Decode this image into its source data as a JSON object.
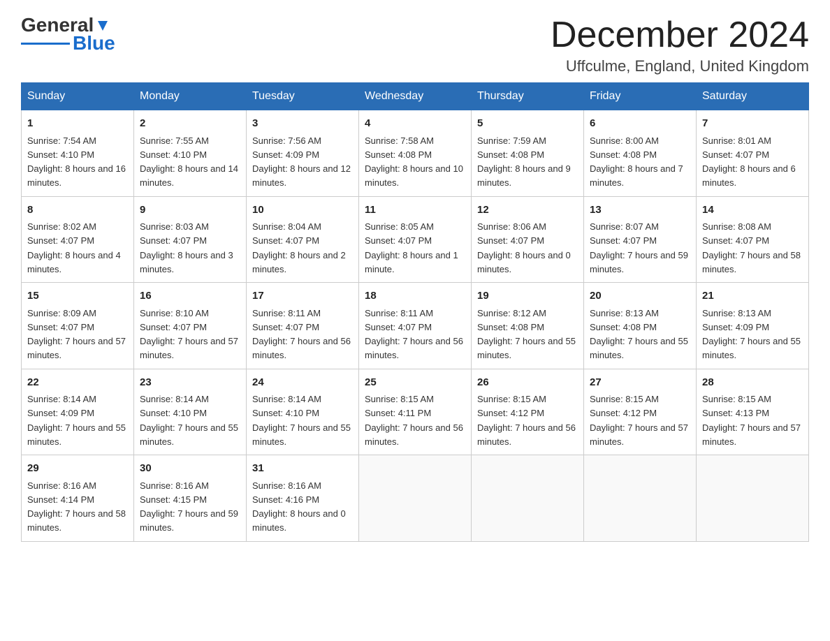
{
  "header": {
    "logo_general": "General",
    "logo_blue": "Blue",
    "month_title": "December 2024",
    "location": "Uffculme, England, United Kingdom"
  },
  "days_of_week": [
    "Sunday",
    "Monday",
    "Tuesday",
    "Wednesday",
    "Thursday",
    "Friday",
    "Saturday"
  ],
  "weeks": [
    [
      {
        "day": "1",
        "sunrise": "7:54 AM",
        "sunset": "4:10 PM",
        "daylight": "8 hours and 16 minutes."
      },
      {
        "day": "2",
        "sunrise": "7:55 AM",
        "sunset": "4:10 PM",
        "daylight": "8 hours and 14 minutes."
      },
      {
        "day": "3",
        "sunrise": "7:56 AM",
        "sunset": "4:09 PM",
        "daylight": "8 hours and 12 minutes."
      },
      {
        "day": "4",
        "sunrise": "7:58 AM",
        "sunset": "4:08 PM",
        "daylight": "8 hours and 10 minutes."
      },
      {
        "day": "5",
        "sunrise": "7:59 AM",
        "sunset": "4:08 PM",
        "daylight": "8 hours and 9 minutes."
      },
      {
        "day": "6",
        "sunrise": "8:00 AM",
        "sunset": "4:08 PM",
        "daylight": "8 hours and 7 minutes."
      },
      {
        "day": "7",
        "sunrise": "8:01 AM",
        "sunset": "4:07 PM",
        "daylight": "8 hours and 6 minutes."
      }
    ],
    [
      {
        "day": "8",
        "sunrise": "8:02 AM",
        "sunset": "4:07 PM",
        "daylight": "8 hours and 4 minutes."
      },
      {
        "day": "9",
        "sunrise": "8:03 AM",
        "sunset": "4:07 PM",
        "daylight": "8 hours and 3 minutes."
      },
      {
        "day": "10",
        "sunrise": "8:04 AM",
        "sunset": "4:07 PM",
        "daylight": "8 hours and 2 minutes."
      },
      {
        "day": "11",
        "sunrise": "8:05 AM",
        "sunset": "4:07 PM",
        "daylight": "8 hours and 1 minute."
      },
      {
        "day": "12",
        "sunrise": "8:06 AM",
        "sunset": "4:07 PM",
        "daylight": "8 hours and 0 minutes."
      },
      {
        "day": "13",
        "sunrise": "8:07 AM",
        "sunset": "4:07 PM",
        "daylight": "7 hours and 59 minutes."
      },
      {
        "day": "14",
        "sunrise": "8:08 AM",
        "sunset": "4:07 PM",
        "daylight": "7 hours and 58 minutes."
      }
    ],
    [
      {
        "day": "15",
        "sunrise": "8:09 AM",
        "sunset": "4:07 PM",
        "daylight": "7 hours and 57 minutes."
      },
      {
        "day": "16",
        "sunrise": "8:10 AM",
        "sunset": "4:07 PM",
        "daylight": "7 hours and 57 minutes."
      },
      {
        "day": "17",
        "sunrise": "8:11 AM",
        "sunset": "4:07 PM",
        "daylight": "7 hours and 56 minutes."
      },
      {
        "day": "18",
        "sunrise": "8:11 AM",
        "sunset": "4:07 PM",
        "daylight": "7 hours and 56 minutes."
      },
      {
        "day": "19",
        "sunrise": "8:12 AM",
        "sunset": "4:08 PM",
        "daylight": "7 hours and 55 minutes."
      },
      {
        "day": "20",
        "sunrise": "8:13 AM",
        "sunset": "4:08 PM",
        "daylight": "7 hours and 55 minutes."
      },
      {
        "day": "21",
        "sunrise": "8:13 AM",
        "sunset": "4:09 PM",
        "daylight": "7 hours and 55 minutes."
      }
    ],
    [
      {
        "day": "22",
        "sunrise": "8:14 AM",
        "sunset": "4:09 PM",
        "daylight": "7 hours and 55 minutes."
      },
      {
        "day": "23",
        "sunrise": "8:14 AM",
        "sunset": "4:10 PM",
        "daylight": "7 hours and 55 minutes."
      },
      {
        "day": "24",
        "sunrise": "8:14 AM",
        "sunset": "4:10 PM",
        "daylight": "7 hours and 55 minutes."
      },
      {
        "day": "25",
        "sunrise": "8:15 AM",
        "sunset": "4:11 PM",
        "daylight": "7 hours and 56 minutes."
      },
      {
        "day": "26",
        "sunrise": "8:15 AM",
        "sunset": "4:12 PM",
        "daylight": "7 hours and 56 minutes."
      },
      {
        "day": "27",
        "sunrise": "8:15 AM",
        "sunset": "4:12 PM",
        "daylight": "7 hours and 57 minutes."
      },
      {
        "day": "28",
        "sunrise": "8:15 AM",
        "sunset": "4:13 PM",
        "daylight": "7 hours and 57 minutes."
      }
    ],
    [
      {
        "day": "29",
        "sunrise": "8:16 AM",
        "sunset": "4:14 PM",
        "daylight": "7 hours and 58 minutes."
      },
      {
        "day": "30",
        "sunrise": "8:16 AM",
        "sunset": "4:15 PM",
        "daylight": "7 hours and 59 minutes."
      },
      {
        "day": "31",
        "sunrise": "8:16 AM",
        "sunset": "4:16 PM",
        "daylight": "8 hours and 0 minutes."
      },
      null,
      null,
      null,
      null
    ]
  ]
}
